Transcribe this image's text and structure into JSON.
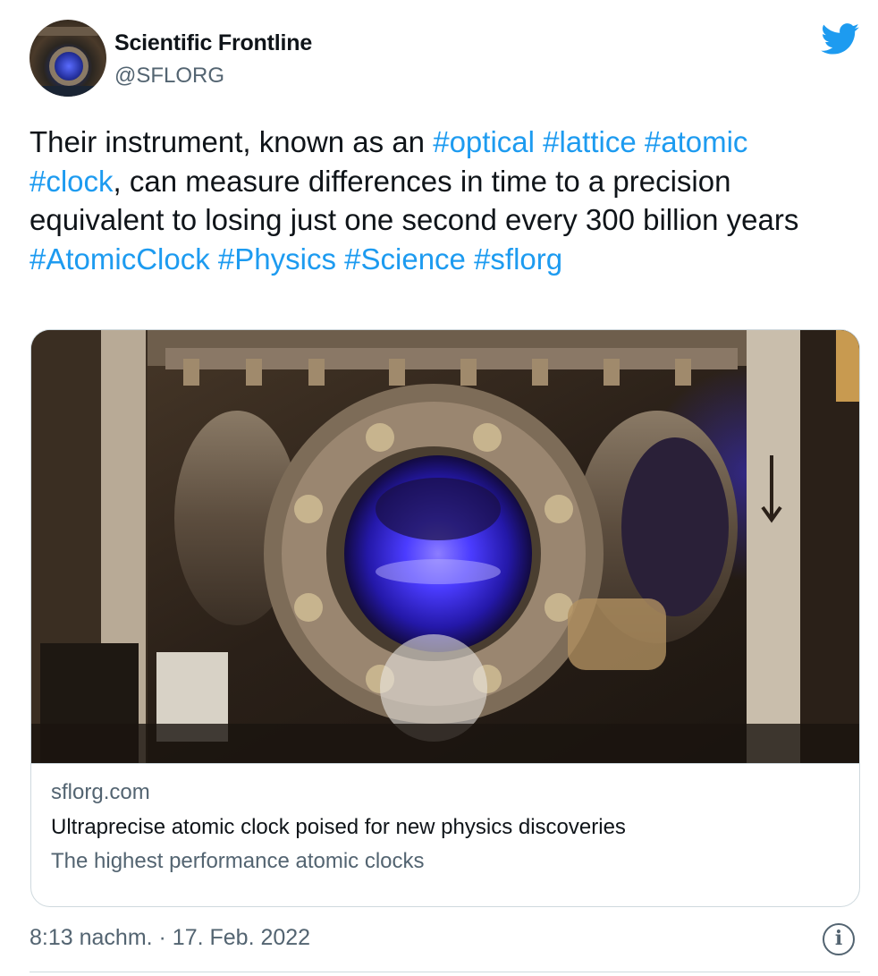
{
  "author": {
    "name": "Scientific Frontline",
    "handle": "@SFLORG"
  },
  "tweet": {
    "segments": [
      {
        "text": "Their instrument, known as an ",
        "type": "text"
      },
      {
        "text": "#optical",
        "type": "hashtag"
      },
      {
        "text": " ",
        "type": "text"
      },
      {
        "text": "#lattice",
        "type": "hashtag"
      },
      {
        "text": " ",
        "type": "text"
      },
      {
        "text": "#atomic",
        "type": "hashtag"
      },
      {
        "text": " ",
        "type": "text"
      },
      {
        "text": "#clock",
        "type": "hashtag"
      },
      {
        "text": ", can measure differences in time to a precision equivalent to losing just one second every 300 billion years",
        "type": "text"
      },
      {
        "text": "\n",
        "type": "break"
      },
      {
        "text": "#AtomicClock",
        "type": "hashtag"
      },
      {
        "text": " ",
        "type": "text"
      },
      {
        "text": "#Physics",
        "type": "hashtag"
      },
      {
        "text": " ",
        "type": "text"
      },
      {
        "text": "#Science",
        "type": "hashtag"
      },
      {
        "text": " ",
        "type": "text"
      },
      {
        "text": "#sflorg",
        "type": "hashtag"
      }
    ]
  },
  "card": {
    "domain": "sflorg.com",
    "title": "Ultraprecise atomic clock poised for new physics discoveries",
    "description": "The highest performance atomic clocks"
  },
  "footer": {
    "timestamp": "8:13 nachm. · 17. Feb. 2022",
    "info_glyph": "i"
  },
  "icons": {
    "bird": "twitter-bird-icon",
    "info": "info-icon"
  },
  "colors": {
    "accent": "#1d9bf0",
    "text": "#0f1419",
    "secondary": "#536471",
    "border": "#cfd9de",
    "laser": "#4b3cff"
  }
}
